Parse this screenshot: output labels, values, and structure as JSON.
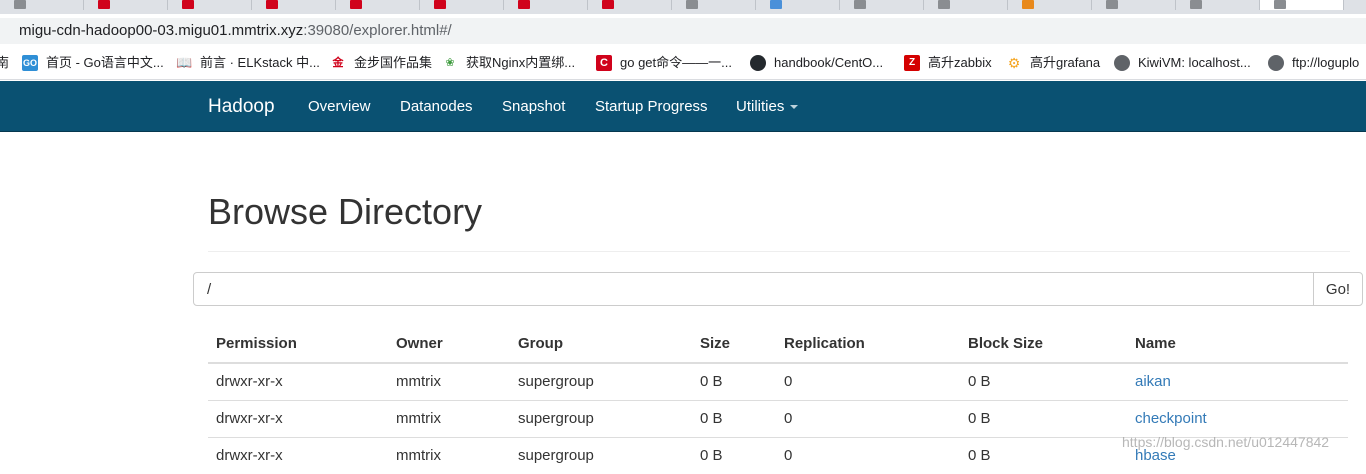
{
  "browser": {
    "url_host": "migu-cdn-hadoop00-03.migu01.mmtrix.xyz",
    "url_path": ":39080/explorer.html#/",
    "bookmarks": [
      {
        "label": "首页 - Go语言中文...",
        "icon": "go-icon",
        "color": "#2f8fd6"
      },
      {
        "label": "前言 · ELKstack 中...",
        "icon": "book-icon",
        "color": "#444444"
      },
      {
        "label": "金步国作品集",
        "icon": "jin-icon",
        "color": "#d0021b"
      },
      {
        "label": "获取Nginx内置绑...",
        "icon": "leaf-icon",
        "color": "#3c9a3c"
      },
      {
        "label": "go get命令——一...",
        "icon": "csdn-icon",
        "color": "#d0021b"
      },
      {
        "label": "handbook/CentO...",
        "icon": "github-icon",
        "color": "#24292e"
      },
      {
        "label": "高升zabbix",
        "icon": "zabbix-icon",
        "color": "#d40000"
      },
      {
        "label": "高升grafana",
        "icon": "grafana-icon",
        "color": "#f5a623"
      },
      {
        "label": "KiwiVM: localhost...",
        "icon": "globe-icon",
        "color": "#5f6368"
      },
      {
        "label": "ftp://loguplo",
        "icon": "globe-icon",
        "color": "#5f6368"
      }
    ]
  },
  "navbar": {
    "brand": "Hadoop",
    "links": [
      "Overview",
      "Datanodes",
      "Snapshot",
      "Startup Progress",
      "Utilities"
    ]
  },
  "main": {
    "title": "Browse Directory",
    "path_value": "/",
    "go_label": "Go!"
  },
  "table": {
    "headers": [
      "Permission",
      "Owner",
      "Group",
      "Size",
      "Replication",
      "Block Size",
      "Name"
    ],
    "rows": [
      {
        "permission": "drwxr-xr-x",
        "owner": "mmtrix",
        "group": "supergroup",
        "size": "0 B",
        "replication": "0",
        "block_size": "0 B",
        "name": "aikan"
      },
      {
        "permission": "drwxr-xr-x",
        "owner": "mmtrix",
        "group": "supergroup",
        "size": "0 B",
        "replication": "0",
        "block_size": "0 B",
        "name": "checkpoint"
      },
      {
        "permission": "drwxr-xr-x",
        "owner": "mmtrix",
        "group": "supergroup",
        "size": "0 B",
        "replication": "0",
        "block_size": "0 B",
        "name": "hbase"
      }
    ]
  },
  "watermark": "https://blog.csdn.net/u012447842",
  "colors": {
    "navbar": "#0a5172",
    "link": "#337ab7"
  }
}
